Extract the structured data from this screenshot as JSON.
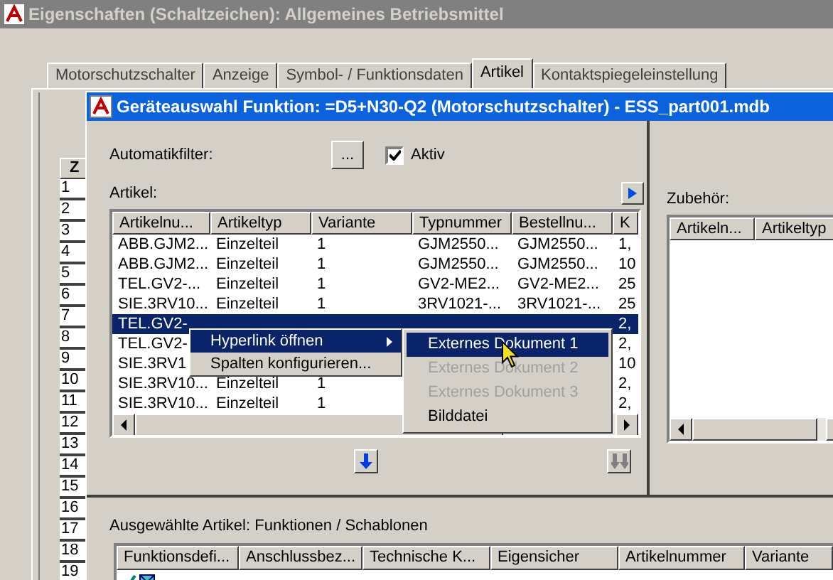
{
  "window": {
    "title": "Eigenschaften (Schaltzeichen): Allgemeines Betriebsmittel"
  },
  "tabs": [
    {
      "label": "Motorschutzschalter",
      "selected": false
    },
    {
      "label": "Anzeige",
      "selected": false
    },
    {
      "label": "Symbol- / Funktionsdaten",
      "selected": false
    },
    {
      "label": "Artikel",
      "selected": true
    },
    {
      "label": "Kontaktspiegeleinstellung",
      "selected": false
    }
  ],
  "background_grid": {
    "header": "Z",
    "row_numbers": [
      "1",
      "2",
      "3",
      "4",
      "5",
      "6",
      "7",
      "8",
      "9",
      "10",
      "11",
      "12",
      "13",
      "14",
      "15",
      "16",
      "17",
      "18",
      "19"
    ]
  },
  "dialog": {
    "title": "Geräteauswahl Funktion: =D5+N30-Q2 (Motorschutzschalter) - ESS_part001.mdb",
    "filter": {
      "label": "Automatikfilter:",
      "button": "...",
      "checkbox_label": "Aktiv",
      "checked": true
    },
    "articles": {
      "label": "Artikel:",
      "columns": [
        "Artikelnu...",
        "Artikeltyp",
        "Variante",
        "Typnummer",
        "Bestellnu...",
        "K"
      ],
      "rows": [
        {
          "selected": false,
          "cells": [
            "ABB.GJM2...",
            "Einzelteil",
            "1",
            "GJM2550...",
            "GJM2550...",
            "1,"
          ]
        },
        {
          "selected": false,
          "cells": [
            "ABB.GJM2...",
            "Einzelteil",
            "1",
            "GJM2550...",
            "GJM2550...",
            "10"
          ]
        },
        {
          "selected": false,
          "cells": [
            "TEL.GV2-...",
            "Einzelteil",
            "1",
            "GV2-ME2...",
            "GV2-ME2...",
            "25"
          ]
        },
        {
          "selected": false,
          "cells": [
            "SIE.3RV10...",
            "Einzelteil",
            "1",
            "3RV1021-...",
            "3RV1021-...",
            "25"
          ]
        },
        {
          "selected": true,
          "cells": [
            "TEL.GV2-",
            null,
            null,
            null,
            null,
            "2,"
          ]
        },
        {
          "selected": false,
          "cells": [
            "TEL.GV2-",
            null,
            null,
            null,
            null,
            "2,"
          ]
        },
        {
          "selected": false,
          "cells": [
            "SIE.3RV1",
            null,
            null,
            null,
            null,
            "10"
          ]
        },
        {
          "selected": false,
          "cells": [
            "SIE.3RV10...",
            "Einzelteil",
            "1",
            null,
            null,
            "2,"
          ]
        },
        {
          "selected": false,
          "cells": [
            "SIE.3RV10...",
            "Einzelteil",
            "1",
            null,
            null,
            "2,"
          ]
        }
      ]
    },
    "accessories": {
      "label": "Zubehör:",
      "columns": [
        "Artikeln...",
        "Artikeltyp"
      ]
    },
    "move_buttons": [
      {
        "disabled": false
      },
      {
        "disabled": true
      }
    ],
    "selected_articles": {
      "label": "Ausgewählte Artikel: Funktionen / Schablonen",
      "columns": [
        "Funktionsdefi...",
        "Anschlussbez...",
        "Technische K...",
        "Eigensicher",
        "Artikelnummer",
        "Variante"
      ]
    }
  },
  "context_menu": {
    "items": [
      {
        "label": "Hyperlink öffnen",
        "selected": true,
        "submenu": true
      },
      {
        "label": "Spalten konfigurieren...",
        "selected": false,
        "submenu": false
      }
    ]
  },
  "submenu": {
    "items": [
      {
        "label": "Externes Dokument 1",
        "selected": true,
        "disabled": false
      },
      {
        "label": "Externes Dokument 2",
        "selected": false,
        "disabled": true
      },
      {
        "label": "Externes Dokument 3",
        "selected": false,
        "disabled": true
      },
      {
        "label": "Bilddatei",
        "selected": false,
        "disabled": false
      }
    ]
  }
}
